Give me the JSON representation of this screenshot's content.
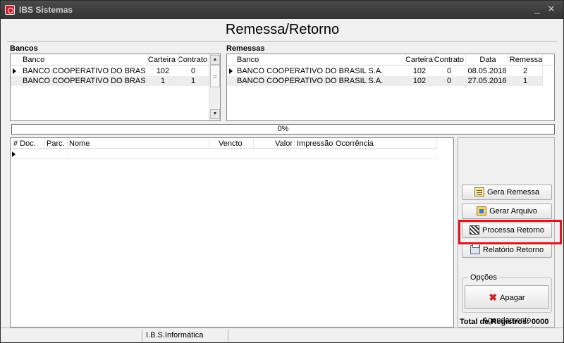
{
  "window": {
    "title": "IBS Sistemas",
    "minimize_glyph": "_",
    "close_glyph": "✕"
  },
  "header": {
    "title": "Remessa/Retorno"
  },
  "bancos": {
    "label": "Bancos",
    "columns": [
      "Banco",
      "Carteira",
      "Contrato"
    ],
    "rows": [
      {
        "banco": "BANCO COOPERATIVO DO BRASIL S",
        "carteira": "102",
        "contrato": "0",
        "selected": true
      },
      {
        "banco": "BANCO COOPERATIVO DO BRASIL S",
        "carteira": "1",
        "contrato": "1",
        "selected": false
      }
    ]
  },
  "remessas": {
    "label": "Remessas",
    "columns": [
      "Banco",
      "Carteira",
      "Contrato",
      "Data",
      "Remessa"
    ],
    "rows": [
      {
        "banco": "BANCO COOPERATIVO DO BRASIL S.A.",
        "carteira": "102",
        "contrato": "0",
        "data": "08.05.2018",
        "remessa": "2",
        "selected": true
      },
      {
        "banco": "BANCO COOPERATIVO DO BRASIL S.A.",
        "carteira": "102",
        "contrato": "0",
        "data": "27.05.2016",
        "remessa": "1",
        "selected": false
      }
    ]
  },
  "progress": {
    "text": "0%",
    "value": 0
  },
  "documentos": {
    "columns": [
      "# Doc.",
      "Parc.",
      "Nome",
      "Vencto",
      "Valor",
      "Impressão",
      "Ocorrência"
    ],
    "rows": []
  },
  "actions": {
    "gera_remessa": "Gera Remessa",
    "gerar_arquivo": "Gerar Arquivo",
    "processa_retorno": "Processa Retorno",
    "relatorio_retorno": "Relatório Retorno"
  },
  "opcoes": {
    "legend": "Opções",
    "apagar_agendamento": "Apagar Agendamento"
  },
  "total": {
    "label": "Total de Registros: 0000"
  },
  "status": {
    "company": "I.B.S.Informática"
  },
  "colors": {
    "highlight": "#e0161e",
    "title_bar": "#3a3a3a",
    "progress_fill": "#3a7bd5"
  },
  "icons": {
    "app": "ibs-logo-icon",
    "gera_remessa": "document-icon",
    "gerar_arquivo": "file-icon",
    "processa_retorno": "barcode-icon",
    "relatorio_retorno": "printer-icon",
    "apagar": "red-x-icon"
  }
}
